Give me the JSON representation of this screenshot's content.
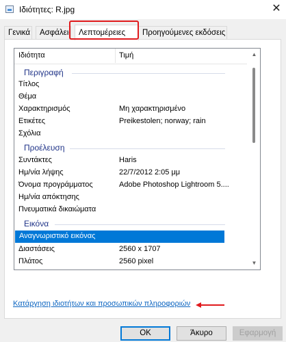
{
  "window": {
    "title": "Ιδιότητες: R.jpg",
    "close_glyph": "✕"
  },
  "tabs": [
    {
      "label": "Γενικά"
    },
    {
      "label": "Ασφάλεια"
    },
    {
      "label": "Λεπτομέρειες",
      "active": true
    },
    {
      "label": "Προηγούμενες εκδόσεις"
    }
  ],
  "list": {
    "columns": {
      "property": "Ιδιότητα",
      "value": "Τιμή"
    },
    "groups": {
      "description": "Περιγραφή",
      "origin": "Προέλευση",
      "image": "Εικόνα"
    },
    "rows": {
      "title": {
        "k": "Τίτλος",
        "v": ""
      },
      "subject": {
        "k": "Θέμα",
        "v": ""
      },
      "rating": {
        "k": "Χαρακτηρισμός",
        "v": "Μη χαρακτηρισμένο"
      },
      "tags": {
        "k": "Ετικέτες",
        "v": "Preikestolen; norway; rain"
      },
      "comments": {
        "k": "Σχόλια",
        "v": ""
      },
      "authors": {
        "k": "Συντάκτες",
        "v": "Haris"
      },
      "date_taken": {
        "k": "Ημ/νία λήψης",
        "v": "22/7/2012 2:05 μμ"
      },
      "program": {
        "k": "Όνομα προγράμματος",
        "v": "Adobe Photoshop Lightroom 5...."
      },
      "date_acquired": {
        "k": "Ημ/νία απόκτησης",
        "v": ""
      },
      "copyright": {
        "k": "Πνευματικά δικαιώματα",
        "v": ""
      },
      "image_id": {
        "k": "Αναγνωριστικό εικόνας",
        "v": ""
      },
      "dimensions": {
        "k": "Διαστάσεις",
        "v": "2560 x 1707"
      },
      "width": {
        "k": "Πλάτος",
        "v": "2560 pixel"
      }
    }
  },
  "remove_link": "Κατάργηση ιδιοτήτων και προσωπικών πληροφοριών",
  "buttons": {
    "ok": "OK",
    "cancel": "Άκυρο",
    "apply": "Εφαρμογή"
  },
  "colors": {
    "highlight": "#e0191c",
    "selection": "#0078d7",
    "group_text": "#1e3287",
    "link": "#0b64c0"
  },
  "icons": {
    "title": "image-file-icon",
    "scroll_up": "scroll-up-icon",
    "scroll_down": "scroll-down-icon"
  }
}
